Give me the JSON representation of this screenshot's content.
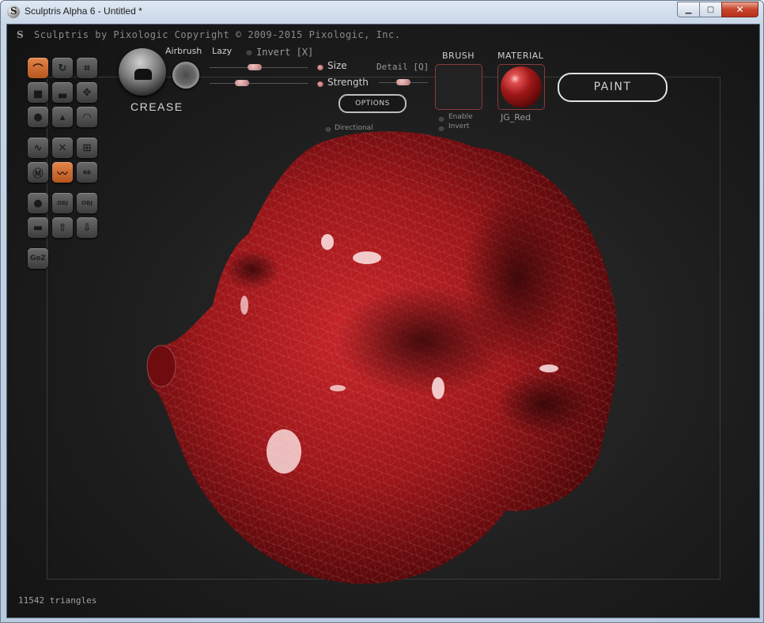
{
  "window": {
    "title": "Sculptris Alpha 6 - Untitled *",
    "minimize": "0",
    "maximize": "1",
    "close": "✕"
  },
  "header": {
    "copyright": "Sculptris by Pixologic   Copyright © 2009-2015 Pixologic, Inc."
  },
  "toolbar": {
    "current_tool": "CREASE",
    "airbrush_label": "Airbrush",
    "lazy_label": "Lazy",
    "invert_label": "Invert [X]",
    "size_label": "Size",
    "strength_label": "Strength",
    "detail_label": "Detail [Q]",
    "options_label": "OPTIONS",
    "directional_label": "Directional",
    "brush_header": "BRUSH",
    "material_header": "MATERIAL",
    "material_name": "JG_Red",
    "enable_label": "Enable",
    "brush_invert_label": "Invert",
    "paint_label": "PAINT",
    "size_value": 0.45,
    "strength_value": 0.3,
    "detail_value": 0.5
  },
  "tools": {
    "goz_label": "GoZ",
    "obj_import_label": "OBJ",
    "obj_export_label": "OBJ"
  },
  "status": {
    "triangles": "11542 triangles"
  },
  "colors": {
    "accent": "#c9641f",
    "model": "#a01a1c",
    "background": "#1d1d1d"
  }
}
